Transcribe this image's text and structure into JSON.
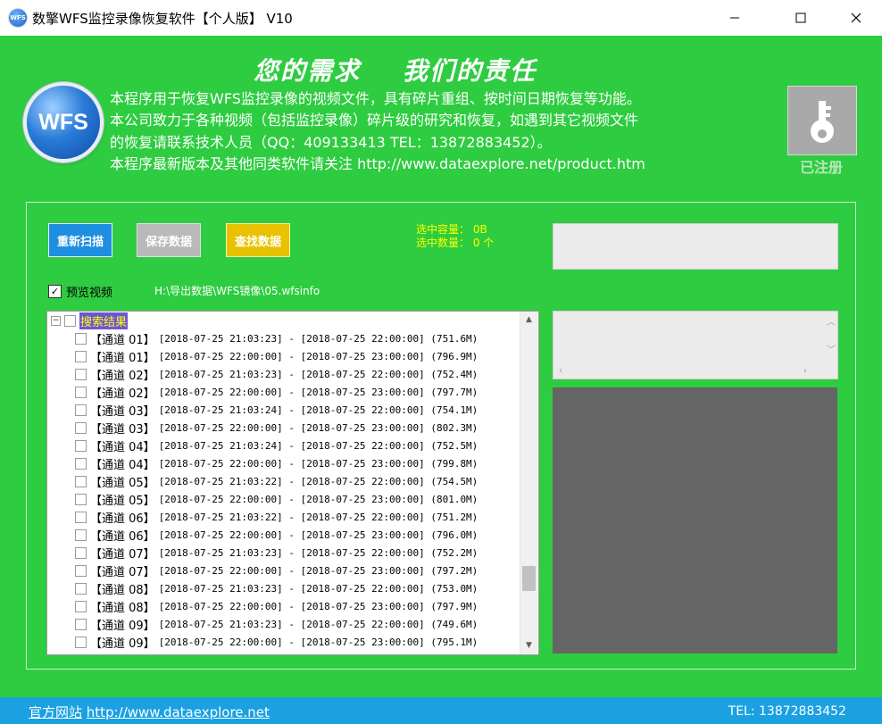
{
  "window": {
    "title": "数擎WFS监控录像恢复软件【个人版】 V10",
    "app_icon_text": "WFS"
  },
  "header": {
    "slogan": "您的需求    我们的责任",
    "logo_text": "WFS",
    "description": [
      "本程序用于恢复WFS监控录像的视频文件，具有碎片重组、按时间日期恢复等功能。",
      "本公司致力于各种视频（包括监控录像）碎片级的研究和恢复，如遇到其它视频文件",
      "的恢复请联系技术人员（QQ：409133413  TEL：13872883452）。",
      "本程序最新版本及其他同类软件请关注 http://www.dataexplore.net/product.htm"
    ],
    "registered_label": "已注册",
    "key_icon": "key-icon"
  },
  "toolbar": {
    "rescan_label": "重新扫描",
    "save_label": "保存数据",
    "search_label": "查找数据"
  },
  "stats": {
    "capacity": "选中容量： 0B",
    "count": "选中数量： 0 个"
  },
  "preview_option": {
    "label": "预览视频",
    "checked": true,
    "path": "H:\\导出数据\\WFS镜像\\05.wfsinfo"
  },
  "tree": {
    "root_label": "搜索结果",
    "rows": [
      {
        "channel": "【通道 01】",
        "range": "[2018-07-25 21:03:23] - [2018-07-25 22:00:00] (751.6M)"
      },
      {
        "channel": "【通道 01】",
        "range": "[2018-07-25 22:00:00] - [2018-07-25 23:00:00] (796.9M)"
      },
      {
        "channel": "【通道 02】",
        "range": "[2018-07-25 21:03:23] - [2018-07-25 22:00:00] (752.4M)"
      },
      {
        "channel": "【通道 02】",
        "range": "[2018-07-25 22:00:00] - [2018-07-25 23:00:00] (797.7M)"
      },
      {
        "channel": "【通道 03】",
        "range": "[2018-07-25 21:03:24] - [2018-07-25 22:00:00] (754.1M)"
      },
      {
        "channel": "【通道 03】",
        "range": "[2018-07-25 22:00:00] - [2018-07-25 23:00:00] (802.3M)"
      },
      {
        "channel": "【通道 04】",
        "range": "[2018-07-25 21:03:24] - [2018-07-25 22:00:00] (752.5M)"
      },
      {
        "channel": "【通道 04】",
        "range": "[2018-07-25 22:00:00] - [2018-07-25 23:00:00] (799.8M)"
      },
      {
        "channel": "【通道 05】",
        "range": "[2018-07-25 21:03:22] - [2018-07-25 22:00:00] (754.5M)"
      },
      {
        "channel": "【通道 05】",
        "range": "[2018-07-25 22:00:00] - [2018-07-25 23:00:00] (801.0M)"
      },
      {
        "channel": "【通道 06】",
        "range": "[2018-07-25 21:03:22] - [2018-07-25 22:00:00] (751.2M)"
      },
      {
        "channel": "【通道 06】",
        "range": "[2018-07-25 22:00:00] - [2018-07-25 23:00:00] (796.0M)"
      },
      {
        "channel": "【通道 07】",
        "range": "[2018-07-25 21:03:23] - [2018-07-25 22:00:00] (752.2M)"
      },
      {
        "channel": "【通道 07】",
        "range": "[2018-07-25 22:00:00] - [2018-07-25 23:00:00] (797.2M)"
      },
      {
        "channel": "【通道 08】",
        "range": "[2018-07-25 21:03:23] - [2018-07-25 22:00:00] (753.0M)"
      },
      {
        "channel": "【通道 08】",
        "range": "[2018-07-25 22:00:00] - [2018-07-25 23:00:00] (797.9M)"
      },
      {
        "channel": "【通道 09】",
        "range": "[2018-07-25 21:03:23] - [2018-07-25 22:00:00] (749.6M)"
      },
      {
        "channel": "【通道 09】",
        "range": "[2018-07-25 22:00:00] - [2018-07-25 23:00:00] (795.1M)"
      }
    ]
  },
  "footer": {
    "site_label": "官方网站",
    "site_url": "http://www.dataexplore.net",
    "tel": "TEL: 13872883452"
  },
  "colors": {
    "background": "#2ecc40",
    "footer": "#1ba1e2",
    "rescan_button": "#1e8fe0",
    "save_button": "#b9b9b9",
    "search_button": "#e8c200",
    "stats_text": "#ffff00",
    "tree_root_highlight": "#6b57d6"
  }
}
